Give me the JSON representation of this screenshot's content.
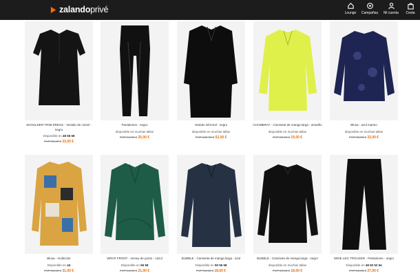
{
  "brand": {
    "name": "zalando",
    "suffix": "privé",
    "accent": "#ff6900"
  },
  "nav": [
    {
      "label": "Lounge",
      "icon": "home-icon"
    },
    {
      "label": "Campañas",
      "icon": "campaigns-icon"
    },
    {
      "label": "Mi cuenta",
      "icon": "user-icon"
    },
    {
      "label": "Cesta",
      "icon": "bag-icon"
    }
  ],
  "products": [
    {
      "name": "SHOULDER TRIM DRESS - Vestido de cóctel - negro",
      "sizes_prefix": "Disponible en",
      "sizes": "48 56 58",
      "old_price": "PVP 89,99 €",
      "price": "33,00 €",
      "color": "#141414"
    },
    {
      "name": "Pantalones - negro",
      "sizes_prefix": "disponible en muchas tallas",
      "sizes": "",
      "old_price": "PVP 64,95 €",
      "price": "25,00 €",
      "color": "#111111"
    },
    {
      "name": "Vestido informal - negro",
      "sizes_prefix": "disponible en muchas tallas",
      "sizes": "",
      "old_price": "PVP 129,99 €",
      "price": "52,00 €",
      "color": "#0d0d0d"
    },
    {
      "name": "CHAMBRAY - Camiseta de manga larga - amarillo",
      "sizes_prefix": "disponible en muchas tallas",
      "sizes": "",
      "old_price": "PVP 59,95 €",
      "price": "19,00 €",
      "color": "#dff04a"
    },
    {
      "name": "Blusa - azul marino",
      "sizes_prefix": "disponible en muchas tallas",
      "sizes": "",
      "old_price": "PVP 59,99 €",
      "price": "33,00 €",
      "color": "#1e2552"
    },
    {
      "name": "Blusa - multicolor",
      "sizes_prefix": "Disponible en",
      "sizes": "44",
      "old_price": "PVP 89,99 €",
      "price": "31,00 €",
      "color": "#d9a441"
    },
    {
      "name": "WRAP FRONT - Jersey de punto - cazul",
      "sizes_prefix": "Disponible en",
      "sizes": "56 58",
      "old_price": "PVP 64,95 €",
      "price": "21,00 €",
      "color": "#1f5c47"
    },
    {
      "name": "BUBBLE - Camiseta de manga larga - azul",
      "sizes_prefix": "Disponible en",
      "sizes": "50 56 58",
      "old_price": "PVP 59,95 €",
      "price": "18,00 €",
      "color": "#263244"
    },
    {
      "name": "BUBBLE - Camiseta de manga larga - negro",
      "sizes_prefix": "disponible en muchas tallas",
      "sizes": "",
      "old_price": "PVP 59,95 €",
      "price": "18,00 €",
      "color": "#101010"
    },
    {
      "name": "WIDE LEG TROUSER - Pantalones - negro",
      "sizes_prefix": "Disponible en",
      "sizes": "48 50 52 54",
      "old_price": "PVP 59,95 €",
      "price": "27,00 €",
      "color": "#0f0f0f"
    }
  ]
}
